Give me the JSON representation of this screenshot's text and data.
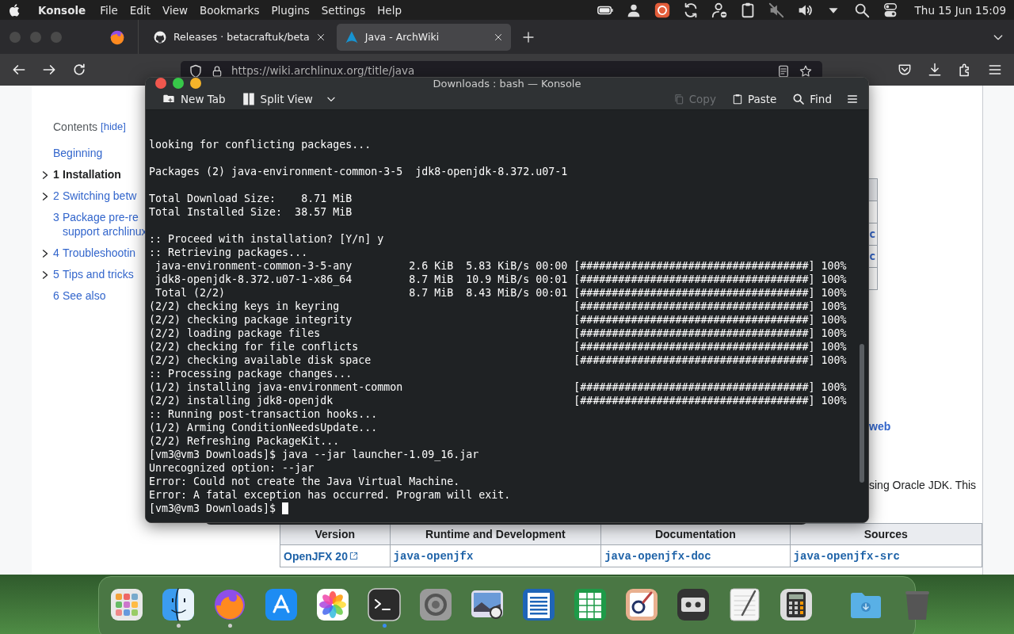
{
  "menubar": {
    "app": "Konsole",
    "menus": [
      "File",
      "Edit",
      "View",
      "Bookmarks",
      "Plugins",
      "Settings",
      "Help"
    ],
    "clock": "Thu 15 Jun 15:09"
  },
  "browser": {
    "tabs": [
      {
        "title": "Releases · betacraftuk/beta",
        "selected": false
      },
      {
        "title": "Java - ArchWiki",
        "selected": true
      }
    ],
    "url": "https://wiki.archlinux.org/title/java"
  },
  "toc": {
    "heading": "Contents",
    "hide_link": "[hide]",
    "items": [
      {
        "lines": [
          "Beginning"
        ],
        "expandable": false,
        "selected": false
      },
      {
        "number": "1",
        "lines": [
          "Installation"
        ],
        "expandable": true,
        "selected": true
      },
      {
        "number": "2",
        "lines": [
          "Switching betw"
        ],
        "expandable": true,
        "selected": false
      },
      {
        "number": "3",
        "lines": [
          "Package pre-re",
          "support archlinux"
        ],
        "expandable": false,
        "selected": false
      },
      {
        "number": "4",
        "lines": [
          "Troubleshootin"
        ],
        "expandable": true,
        "selected": false
      },
      {
        "number": "5",
        "lines": [
          "Tips and tricks"
        ],
        "expandable": true,
        "selected": false
      },
      {
        "number": "6",
        "lines": [
          "See also"
        ],
        "expandable": false,
        "selected": false
      }
    ]
  },
  "side_table": {
    "cells": [
      "",
      "",
      "c",
      "c",
      ""
    ]
  },
  "side_link": "web",
  "side_text": "sing Oracle JDK. This",
  "table": {
    "columns": [
      "Version",
      "Runtime and Development",
      "Documentation",
      "Sources"
    ],
    "rows": [
      [
        "OpenJFX 20",
        "java-openjfx",
        "java-openjfx-doc",
        "java-openjfx-src"
      ]
    ]
  },
  "terminal": {
    "title": "Downloads : bash — Konsole",
    "toolbar": [
      {
        "label": "New Tab",
        "disabled": false
      },
      {
        "label": "Split View",
        "disabled": false
      },
      {
        "label": "Copy",
        "disabled": true
      },
      {
        "label": "Paste",
        "disabled": false
      },
      {
        "label": "Find",
        "disabled": false
      }
    ],
    "blocks": [
      {
        "lines": [
          {
            "kind": "text",
            "text": "looking for conflicting packages..."
          }
        ]
      },
      {
        "lines": [
          {
            "kind": "text",
            "text": "Packages (2) java-environment-common-3-5  jdk8-openjdk-8.372.u07-1"
          }
        ]
      },
      {
        "lines": [
          {
            "kind": "text",
            "text": "Total Download Size:    8.71 MiB"
          },
          {
            "kind": "text",
            "text": "Total Installed Size:  38.57 MiB"
          }
        ]
      },
      {
        "lines": [
          {
            "kind": "text",
            "text": ":: Proceed with installation? [Y/n] y"
          },
          {
            "kind": "text",
            "text": ":: Retrieving packages..."
          },
          {
            "kind": "transfer",
            "label": "java-environment-common-3-5-any",
            "size": "2.6 KiB",
            "speed": "5.83 KiB/s",
            "time": "00:00",
            "bar": "[####################################]",
            "percent": "100%"
          },
          {
            "kind": "transfer",
            "label": "jdk8-openjdk-8.372.u07-1-x86_64",
            "size": "8.7 MiB",
            "speed": "10.9 MiB/s",
            "time": "00:01",
            "bar": "[####################################]",
            "percent": "100%"
          },
          {
            "kind": "transfer",
            "label": "Total (2/2)",
            "size": "8.7 MiB",
            "speed": "8.43 MiB/s",
            "time": "00:01",
            "bar": "[####################################]",
            "percent": "100%"
          },
          {
            "kind": "step",
            "label": "(2/2) checking keys in keyring",
            "bar": "[####################################]",
            "percent": "100%"
          },
          {
            "kind": "step",
            "label": "(2/2) checking package integrity",
            "bar": "[####################################]",
            "percent": "100%"
          },
          {
            "kind": "step",
            "label": "(2/2) loading package files",
            "bar": "[####################################]",
            "percent": "100%"
          },
          {
            "kind": "step",
            "label": "(2/2) checking for file conflicts",
            "bar": "[####################################]",
            "percent": "100%"
          },
          {
            "kind": "step",
            "label": "(2/2) checking available disk space",
            "bar": "[####################################]",
            "percent": "100%"
          },
          {
            "kind": "text",
            "text": ":: Processing package changes..."
          },
          {
            "kind": "step",
            "label": "(1/2) installing java-environment-common",
            "bar": "[####################################]",
            "percent": "100%"
          },
          {
            "kind": "step",
            "label": "(2/2) installing jdk8-openjdk",
            "bar": "[####################################]",
            "percent": "100%"
          },
          {
            "kind": "text",
            "text": ":: Running post-transaction hooks..."
          },
          {
            "kind": "text",
            "text": "(1/2) Arming ConditionNeedsUpdate..."
          },
          {
            "kind": "text",
            "text": "(2/2) Refreshing PackageKit..."
          },
          {
            "kind": "text",
            "text": "[vm3@vm3 Downloads]$ java --jar launcher-1.09_16.jar"
          },
          {
            "kind": "text",
            "text": "Unrecognized option: --jar"
          },
          {
            "kind": "text",
            "text": "Error: Could not create the Java Virtual Machine."
          },
          {
            "kind": "text",
            "text": "Error: A fatal exception has occurred. Program will exit."
          },
          {
            "kind": "prompt",
            "text": "[vm3@vm3 Downloads]$",
            "cursor": true
          }
        ]
      }
    ]
  },
  "dock": {
    "items": [
      {
        "running": false
      },
      {
        "running": true,
        "color": "#cccccc"
      },
      {
        "running": true,
        "color": "#cccccc"
      },
      {
        "running": false
      },
      {
        "running": false
      },
      {
        "running": true,
        "color": "#3b8cf0"
      },
      {
        "running": false
      },
      {
        "running": false
      },
      {
        "running": false
      },
      {
        "running": false
      },
      {
        "running": false
      },
      {
        "running": false
      },
      {
        "running": false
      },
      {
        "running": false
      },
      {
        "running": false
      },
      {
        "running": false
      }
    ]
  }
}
